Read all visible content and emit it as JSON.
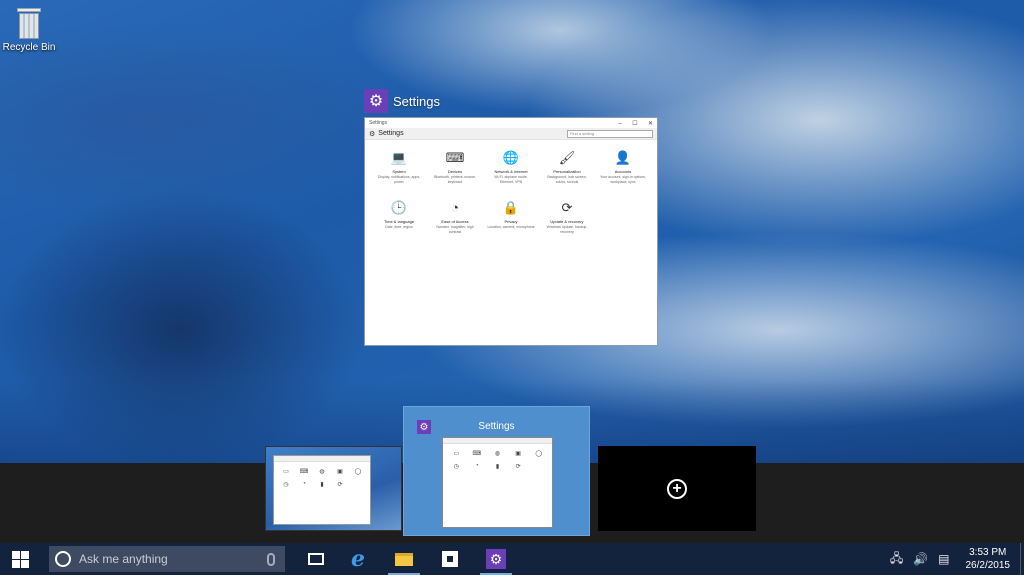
{
  "desktop": {
    "recycle_bin_label": "Recycle Bin"
  },
  "preview": {
    "app_title": "Settings",
    "window": {
      "titlebar_text": "Settings",
      "controls": [
        "–",
        "☐",
        "✕"
      ],
      "header_title": "Settings",
      "search_placeholder": "Find a setting",
      "tiles": [
        {
          "name": "System",
          "desc": "Display, notifications, apps, power",
          "icon": "laptop-icon",
          "glyph": "💻"
        },
        {
          "name": "Devices",
          "desc": "Bluetooth, printers, mouse, keyboard",
          "icon": "devices-icon",
          "glyph": "⌨"
        },
        {
          "name": "Network & Internet",
          "desc": "Wi-Fi, airplane mode, Ethernet, VPN",
          "icon": "globe-icon",
          "glyph": "🌐"
        },
        {
          "name": "Personalization",
          "desc": "Background, lock screen, colors, sounds",
          "icon": "personalization-icon",
          "glyph": "🖌"
        },
        {
          "name": "Accounts",
          "desc": "Your account, sign-in options, workplace, sync",
          "icon": "person-icon",
          "glyph": "👤"
        },
        {
          "name": "Time & language",
          "desc": "Date, time, region",
          "icon": "time-language-icon",
          "glyph": "🕒"
        },
        {
          "name": "Ease of Access",
          "desc": "Narrator, magnifier, high contrast",
          "icon": "ease-of-access-icon",
          "glyph": "◔"
        },
        {
          "name": "Privacy",
          "desc": "Location, camera, microphone",
          "icon": "lock-icon",
          "glyph": "🔒"
        },
        {
          "name": "Update & recovery",
          "desc": "Windows Update, backup, recovery",
          "icon": "update-icon",
          "glyph": "⟳"
        }
      ]
    }
  },
  "task_view": {
    "thumbnails": [
      {
        "title": ""
      },
      {
        "title": "Settings"
      }
    ],
    "new_desktop_symbol": "+"
  },
  "taskbar": {
    "search_placeholder": "Ask me anything",
    "time": "3:53 PM",
    "date": "26/2/2015",
    "accent": "#6b3fb8"
  }
}
